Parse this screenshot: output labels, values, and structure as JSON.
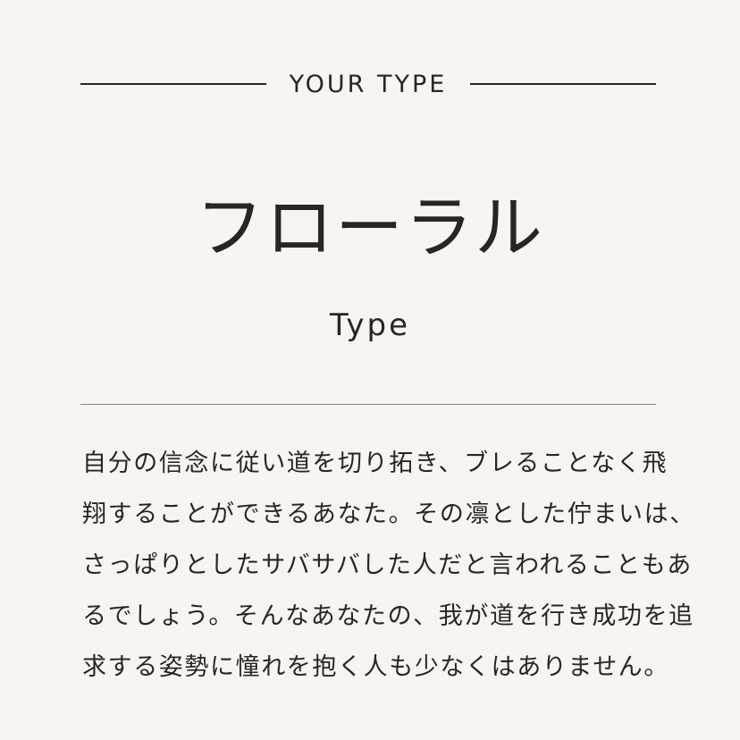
{
  "header": {
    "label": "YOUR TYPE"
  },
  "result": {
    "type_name": "フローラル",
    "type_sub": "Type"
  },
  "description": {
    "lines": [
      "自分の信念に従い道を切り拓き、ブレることなく飛",
      "翔することができるあなた。その凛とした佇まいは、",
      "さっぱりとしたサバサバした人だと言われることもあ",
      "るでしょう。そんなあなたの、我が道を行き成功を追",
      "求する姿勢に憧れを抱く人も少なくはありません。"
    ]
  },
  "colors": {
    "background": "#f8f5f0",
    "text": "#2b2521",
    "divider": "#8a8580"
  }
}
